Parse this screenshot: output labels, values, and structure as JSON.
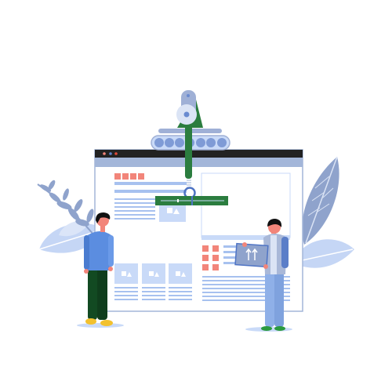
{
  "colors": {
    "background": "#ffffff",
    "browser_titlebar": "#222222",
    "browser_band": "#a3b6d9",
    "line_blue": "#a7c1ef",
    "card_blue": "#c9daf8",
    "accent_red": "#f2857a",
    "robot_green": "#2b7d3f",
    "robot_gray": "#9fb0d6",
    "robot_disc": "#dbe4f5",
    "robot_dot": "#6a8bd0",
    "leaf_light": "#c5d6f5",
    "leaf_dark": "#8fa3cc",
    "shirt_left": "#5b8de0",
    "pants_left": "#124a22",
    "shoes": "#f2c12e",
    "skin": "#f2857a",
    "hair": "#111111",
    "shirt_right": "#a9b8d8",
    "pants_right": "#8fb0e8",
    "shoes_right": "#2b9a3f"
  },
  "icons": [
    "robot-arm-icon",
    "conveyor-icon",
    "browser-window-icon",
    "upload-arrows-icon",
    "image-placeholder-icon"
  ]
}
